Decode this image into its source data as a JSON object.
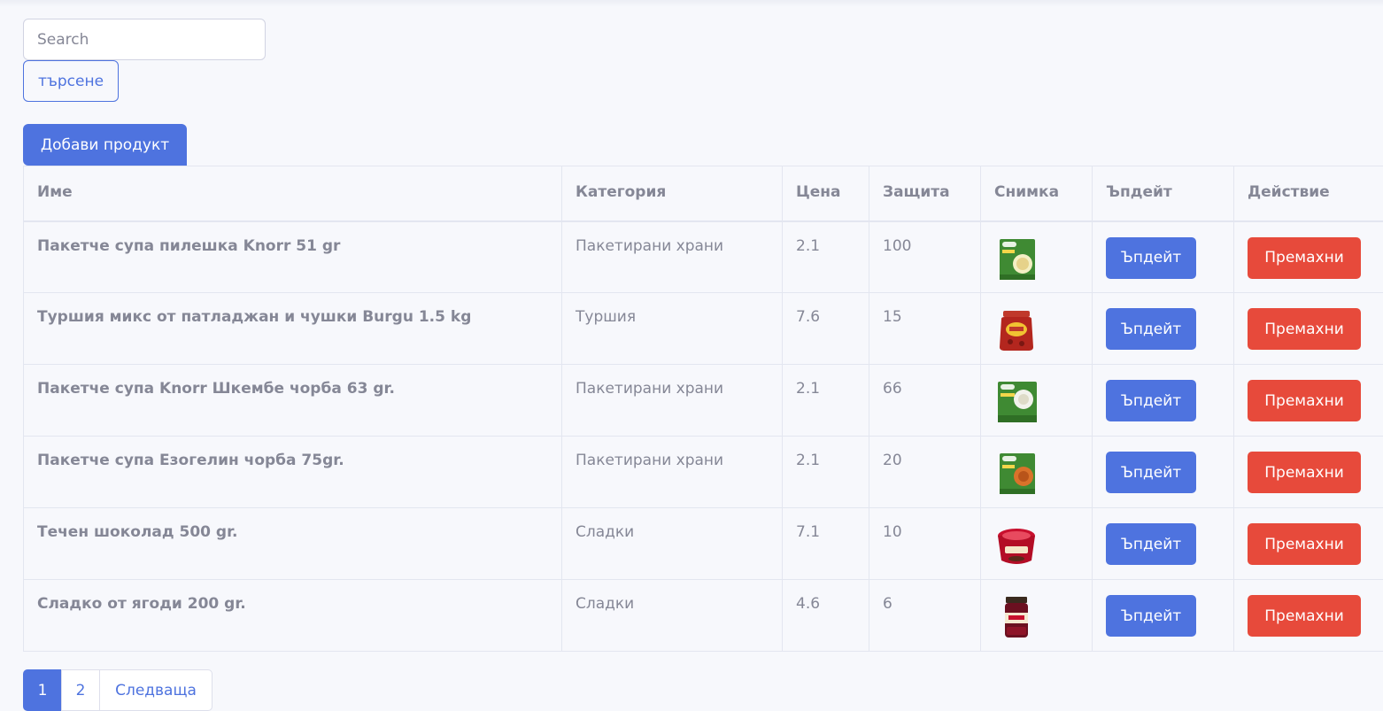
{
  "search": {
    "placeholder": "Search",
    "button_label": "търсене"
  },
  "add_product_label": "Добави продукт",
  "table": {
    "headers": [
      "Име",
      "Категория",
      "Цена",
      "Защита",
      "Снимка",
      "Ъпдейт",
      "Действие"
    ],
    "rows": [
      {
        "name": "Пакетче супа пилешка Knorr 51 gr",
        "category": "Пакетирани храни",
        "price": "2.1",
        "protection": "100",
        "image_icon": "knorr-chicken-soup-packet",
        "update_label": "Ъпдейт",
        "remove_label": "Премахни"
      },
      {
        "name": "Туршия микс от патладжан и чушки Burgu 1.5 kg",
        "category": "Туршия",
        "price": "7.6",
        "protection": "15",
        "image_icon": "pickle-jar",
        "update_label": "Ъпдейт",
        "remove_label": "Премахни"
      },
      {
        "name": "Пакетче супа Knorr Шкембе чорба 63 gr.",
        "category": "Пакетирани храни",
        "price": "2.1",
        "protection": "66",
        "image_icon": "knorr-tripe-soup-packet",
        "update_label": "Ъпдейт",
        "remove_label": "Премахни"
      },
      {
        "name": "Пакетче супа Езогелин чорба 75gr.",
        "category": "Пакетирани храни",
        "price": "2.1",
        "protection": "20",
        "image_icon": "knorr-ezogelin-soup-packet",
        "update_label": "Ъпдейт",
        "remove_label": "Премахни"
      },
      {
        "name": "Течен шоколад 500 gr.",
        "category": "Сладки",
        "price": "7.1",
        "protection": "10",
        "image_icon": "chocolate-tub",
        "update_label": "Ъпдейт",
        "remove_label": "Премахни"
      },
      {
        "name": "Сладко от ягоди 200 gr.",
        "category": "Сладки",
        "price": "4.6",
        "protection": "6",
        "image_icon": "jam-jar",
        "update_label": "Ъпдейт",
        "remove_label": "Премахни"
      }
    ]
  },
  "pagination": {
    "pages": [
      "1",
      "2"
    ],
    "active_page": "1",
    "next_label": "Следваща"
  },
  "colors": {
    "primary": "#4e73df",
    "danger": "#e74a3b",
    "text": "#858796",
    "background": "#f7f8fc"
  }
}
